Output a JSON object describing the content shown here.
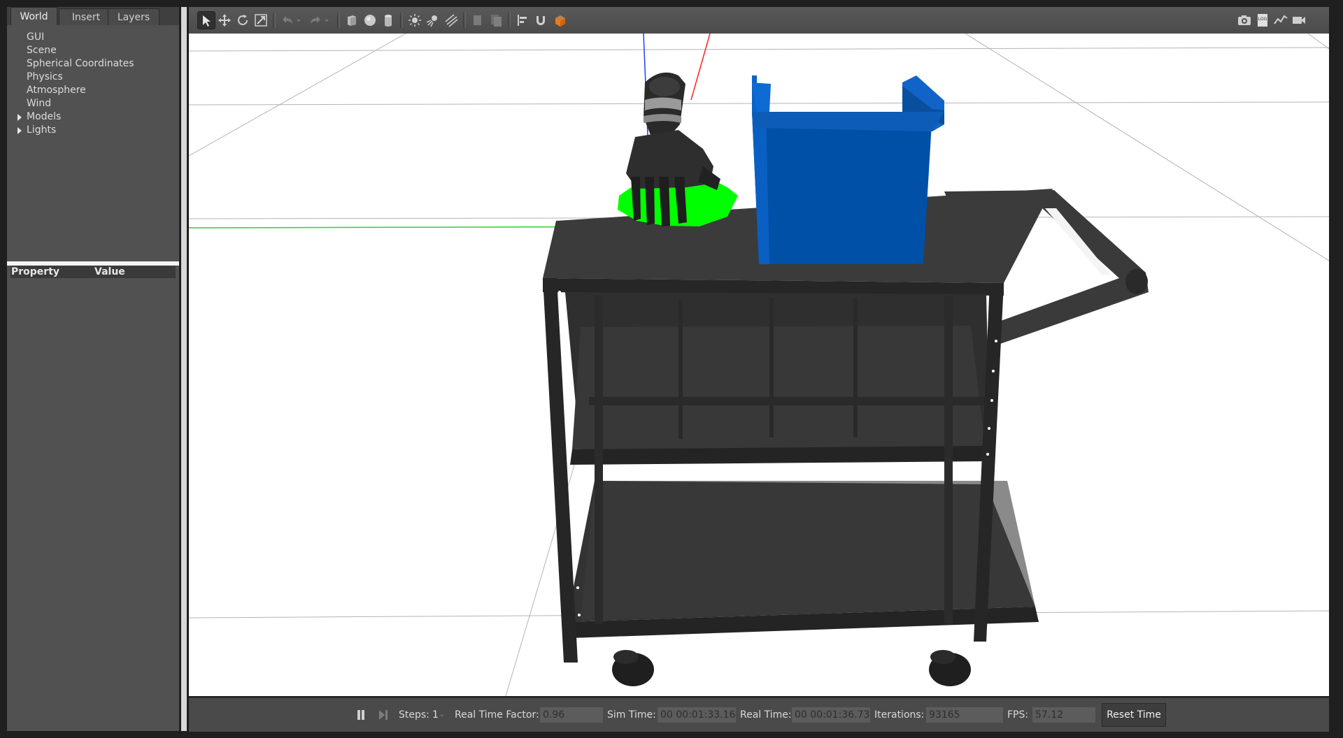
{
  "left_panel": {
    "tabs": [
      {
        "label": "World",
        "active": true
      },
      {
        "label": "Insert",
        "active": false
      },
      {
        "label": "Layers",
        "active": false
      }
    ],
    "tree_items": [
      {
        "label": "GUI",
        "expandable": false
      },
      {
        "label": "Scene",
        "expandable": false
      },
      {
        "label": "Spherical Coordinates",
        "expandable": false
      },
      {
        "label": "Physics",
        "expandable": false
      },
      {
        "label": "Atmosphere",
        "expandable": false
      },
      {
        "label": "Wind",
        "expandable": false
      },
      {
        "label": "Models",
        "expandable": true
      },
      {
        "label": "Lights",
        "expandable": true
      }
    ],
    "property_table": {
      "col_property": "Property",
      "col_value": "Value"
    }
  },
  "toolbar": {
    "tools": [
      {
        "name": "select-mode",
        "active": true
      },
      {
        "name": "translate-mode",
        "active": false
      },
      {
        "name": "rotate-mode",
        "active": false
      },
      {
        "name": "scale-mode",
        "active": false
      },
      {
        "name": "undo",
        "active": false
      },
      {
        "name": "redo",
        "active": false
      },
      {
        "name": "box-shape",
        "active": false
      },
      {
        "name": "sphere-shape",
        "active": false
      },
      {
        "name": "cylinder-shape",
        "active": false
      },
      {
        "name": "point-light",
        "active": false
      },
      {
        "name": "spot-light",
        "active": false
      },
      {
        "name": "directional-light",
        "active": false
      },
      {
        "name": "copy",
        "active": false
      },
      {
        "name": "paste",
        "active": false
      },
      {
        "name": "align",
        "active": false
      },
      {
        "name": "snap",
        "active": false
      },
      {
        "name": "view-angle",
        "active": false
      },
      {
        "name": "screenshot",
        "active": false
      },
      {
        "name": "log",
        "active": false
      },
      {
        "name": "plot",
        "active": false
      },
      {
        "name": "record-video",
        "active": false
      }
    ],
    "log_icon_text": "LOG"
  },
  "scene": {
    "selection_highlight_color": "#00ff00",
    "bin_color": "#0050a8",
    "cart_color": "#333333"
  },
  "statusbar": {
    "steps_label": "Steps:",
    "steps_value": "1",
    "rtf_label": "Real Time Factor:",
    "rtf_value": "0.96",
    "sim_time_label": "Sim Time:",
    "sim_time_value": "00 00:01:33.165",
    "real_time_label": "Real Time:",
    "real_time_value": "00 00:01:36.739",
    "iterations_label": "Iterations:",
    "iterations_value": "93165",
    "fps_label": "FPS:",
    "fps_value": "57.12",
    "reset_label": "Reset Time"
  }
}
